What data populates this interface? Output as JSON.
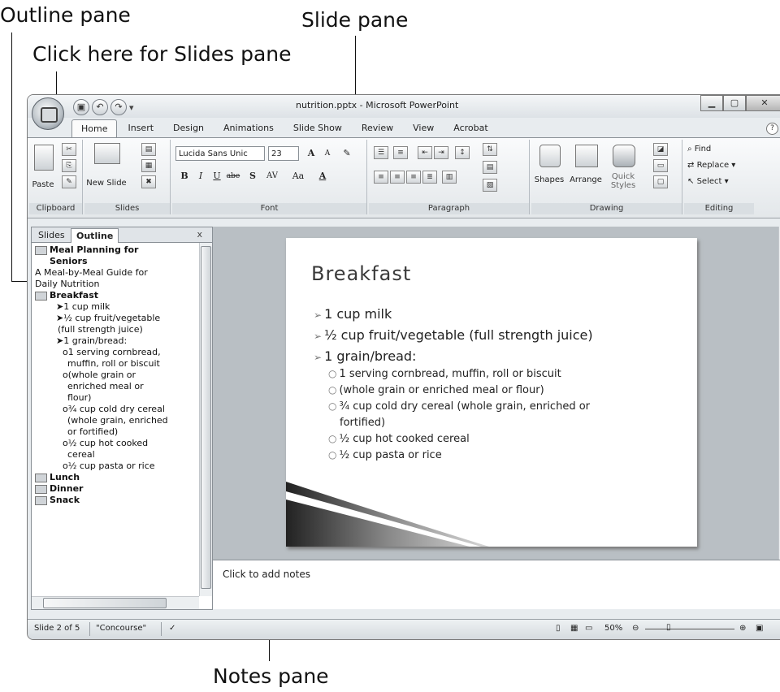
{
  "callouts": {
    "outline_pane": "Outline pane",
    "click_here_slides": "Click here for Slides pane",
    "slide_pane": "Slide pane",
    "notes_pane": "Notes pane"
  },
  "window": {
    "title": "nutrition.pptx - Microsoft PowerPoint",
    "qat_icons": [
      "save-icon",
      "undo-icon",
      "redo-icon",
      "customize-icon"
    ]
  },
  "ribbon_tabs": [
    "Home",
    "Insert",
    "Design",
    "Animations",
    "Slide Show",
    "Review",
    "View",
    "Acrobat"
  ],
  "active_tab": "Home",
  "ribbon": {
    "clipboard": {
      "label": "Clipboard",
      "paste": "Paste"
    },
    "slides": {
      "label": "Slides",
      "new_slide": "New Slide"
    },
    "font": {
      "label": "Font",
      "font_name": "Lucida Sans Unic",
      "font_size": "23",
      "bold": "B",
      "italic": "I",
      "underline": "U",
      "strike": "abe",
      "shadow": "S",
      "spacing": "AV",
      "case": "Aa",
      "color": "A",
      "grow": "A",
      "shrink": "A"
    },
    "paragraph": {
      "label": "Paragraph"
    },
    "drawing": {
      "label": "Drawing",
      "shapes": "Shapes",
      "arrange": "Arrange",
      "quick_styles": "Quick Styles"
    },
    "editing": {
      "label": "Editing",
      "find": "Find",
      "replace": "Replace",
      "select": "Select"
    }
  },
  "left_pane": {
    "tab_slides": "Slides",
    "tab_outline": "Outline",
    "close": "x",
    "outline": [
      {
        "type": "title",
        "text": "Meal Planning for"
      },
      {
        "type": "title-cont",
        "text": "Seniors"
      },
      {
        "type": "body",
        "text": "A Meal-by-Meal Guide for"
      },
      {
        "type": "body",
        "text": "Daily Nutrition"
      },
      {
        "type": "title",
        "text": "Breakfast"
      },
      {
        "type": "b1",
        "text": "➤1 cup  milk"
      },
      {
        "type": "b1",
        "text": "➤½ cup fruit/vegetable"
      },
      {
        "type": "b1c",
        "text": "(full strength juice)"
      },
      {
        "type": "b1",
        "text": "➤1 grain/bread:"
      },
      {
        "type": "b2",
        "text": "o1 serving cornbread,"
      },
      {
        "type": "b2c",
        "text": "muffin, roll or biscuit"
      },
      {
        "type": "b2",
        "text": "o(whole grain or"
      },
      {
        "type": "b2c",
        "text": "enriched meal or"
      },
      {
        "type": "b2c",
        "text": "flour)"
      },
      {
        "type": "b2",
        "text": "o¾ cup  cold dry cereal"
      },
      {
        "type": "b2c",
        "text": "(whole grain, enriched"
      },
      {
        "type": "b2c",
        "text": "or fortified)"
      },
      {
        "type": "b2",
        "text": "o½ cup  hot cooked"
      },
      {
        "type": "b2c",
        "text": "cereal"
      },
      {
        "type": "b2",
        "text": "o½ cup  pasta or rice"
      },
      {
        "type": "title",
        "text": "Lunch"
      },
      {
        "type": "title",
        "text": "Dinner"
      },
      {
        "type": "title",
        "text": "Snack"
      }
    ]
  },
  "slide": {
    "title": "Breakfast",
    "bullets": [
      {
        "level": 1,
        "text": "1 cup milk"
      },
      {
        "level": 1,
        "text": "½ cup fruit/vegetable (full strength juice)"
      },
      {
        "level": 1,
        "text": "1 grain/bread:"
      },
      {
        "level": 2,
        "text": "1 serving cornbread,  muffin, roll or biscuit"
      },
      {
        "level": 2,
        "text": "(whole grain or enriched  meal or flour)"
      },
      {
        "level": 2,
        "text": "¾ cup cold dry cereal (whole grain, enriched  or"
      },
      {
        "level": 2,
        "text": "fortified)",
        "cont": true
      },
      {
        "level": 2,
        "text": "½ cup hot cooked cereal"
      },
      {
        "level": 2,
        "text": "½ cup pasta or rice"
      }
    ],
    "bullet_mark_l1": "➢",
    "bullet_mark_l2": "○"
  },
  "notes": {
    "placeholder": "Click to add notes"
  },
  "status": {
    "slide_info": "Slide 2 of 5",
    "theme": "\"Concourse\"",
    "zoom": "50%"
  }
}
